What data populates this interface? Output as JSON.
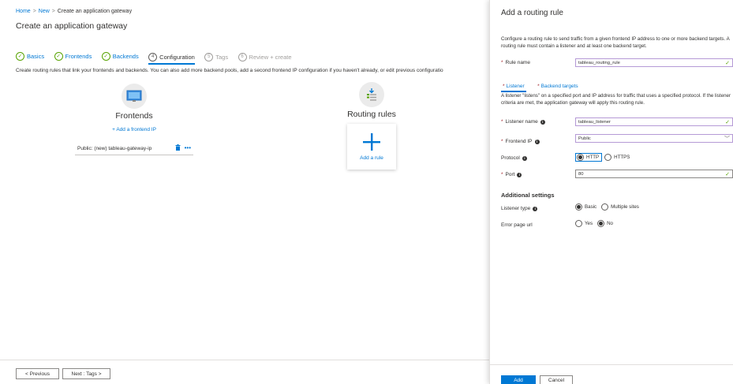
{
  "breadcrumb": {
    "home": "Home",
    "new": "New",
    "current": "Create an application gateway",
    "sep": ">"
  },
  "page_title": "Create an application gateway",
  "tabs": [
    {
      "label": "Basics",
      "state": "done",
      "badge": "✓"
    },
    {
      "label": "Frontends",
      "state": "done",
      "badge": "✓"
    },
    {
      "label": "Backends",
      "state": "done",
      "badge": "✓"
    },
    {
      "label": "Configuration",
      "state": "active",
      "badge": "4"
    },
    {
      "label": "Tags",
      "state": "future",
      "badge": "5"
    },
    {
      "label": "Review + create",
      "state": "future",
      "badge": "6"
    }
  ],
  "description": "Create routing rules that link your frontends and backends. You can also add more backend pools, add a second frontend IP configuration if you haven't already, or edit previous configuratio",
  "frontends": {
    "title": "Frontends",
    "add_link": "+ Add a frontend IP",
    "item": "Public: (new) tableau-gateway-ip",
    "more": "•••"
  },
  "routing_rules": {
    "title": "Routing rules",
    "add_label": "Add a rule"
  },
  "footer": {
    "previous": "< Previous",
    "next": "Next : Tags >"
  },
  "panel": {
    "title": "Add a routing rule",
    "description": "Configure a routing rule to send traffic from a given frontend IP address to one or more backend targets. A routing rule must contain a listener and at least one backend target.",
    "rule_name_label": "Rule name",
    "rule_name_value": "tableau_routing_rule",
    "sub_tabs": {
      "listener": "Listener",
      "backend_targets": "Backend targets"
    },
    "listener_desc": "A listener \"listens\" on a specified port and IP address for traffic that uses a specified protocol. If the listener criteria are met, the application gateway will apply this routing rule.",
    "listener_name_label": "Listener name",
    "listener_name_value": "tableau_listener",
    "frontend_ip_label": "Frontend IP",
    "frontend_ip_value": "Public",
    "protocol_label": "Protocol",
    "protocol_http": "HTTP",
    "protocol_https": "HTTPS",
    "port_label": "Port",
    "port_value": "80",
    "additional_settings": "Additional settings",
    "listener_type_label": "Listener type",
    "listener_type_basic": "Basic",
    "listener_type_multi": "Multiple sites",
    "error_page_label": "Error page url",
    "error_yes": "Yes",
    "error_no": "No",
    "add_button": "Add",
    "cancel_button": "Cancel",
    "required_mark": "*",
    "info_mark": "i",
    "check_mark": "✓",
    "chevron": "﹀"
  },
  "colors": {
    "accent": "#0078d4",
    "success": "#57a300",
    "required": "#a4262c",
    "input_border": "#b59ad6"
  }
}
